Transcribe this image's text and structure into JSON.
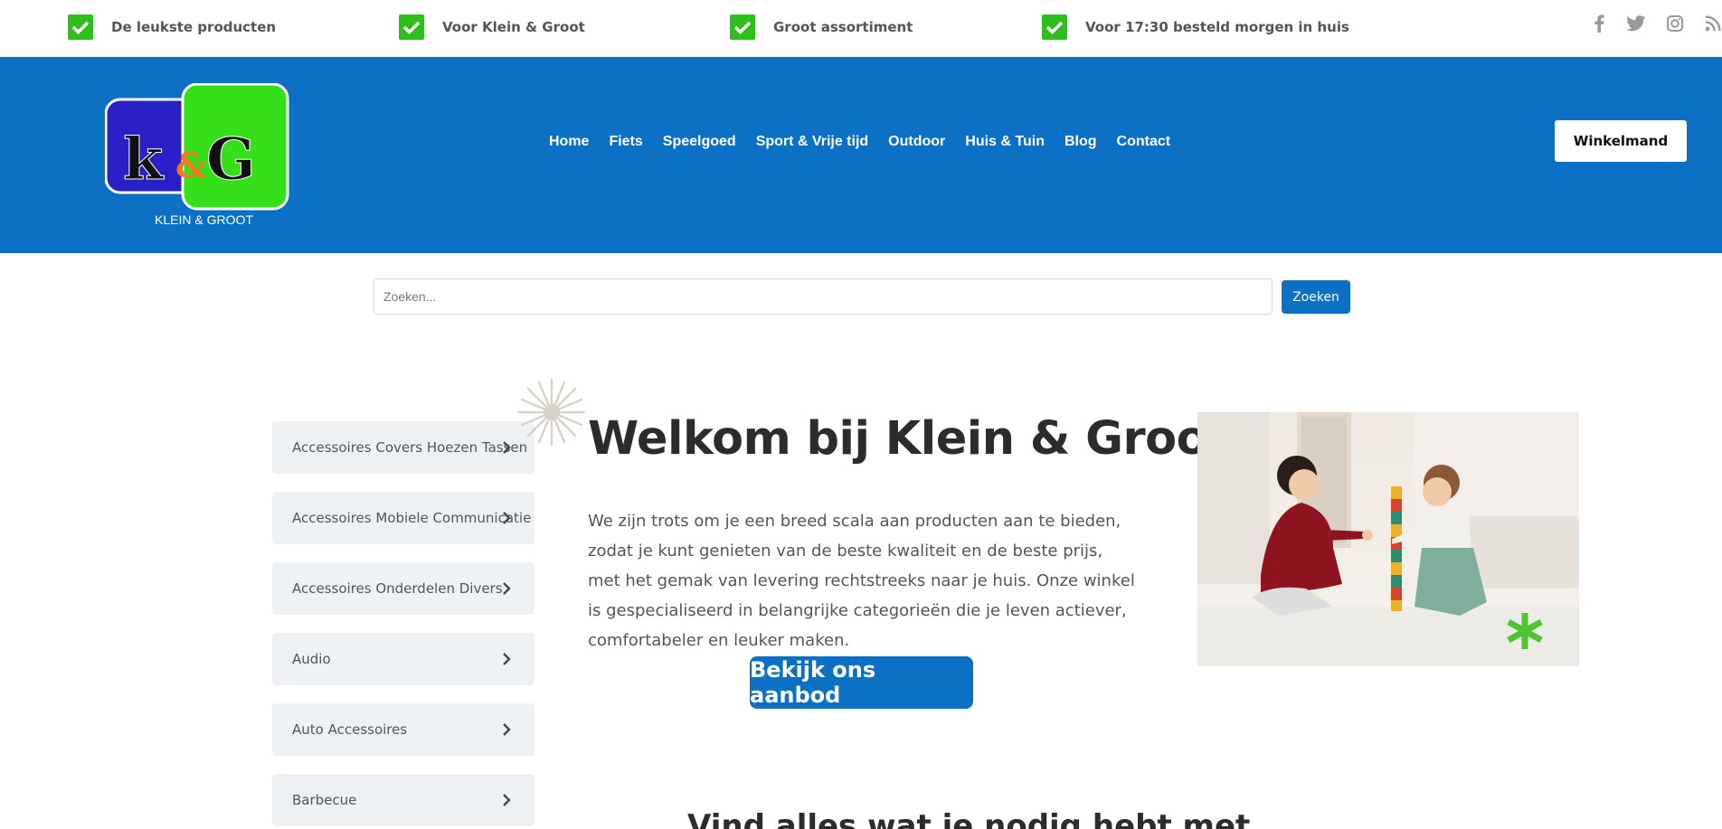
{
  "topbar": {
    "usps": [
      {
        "label": "De leukste producten"
      },
      {
        "label": "Voor Klein & Groot"
      },
      {
        "label": "Groot assortiment"
      },
      {
        "label": "Voor 17:30 besteld morgen in huis"
      }
    ],
    "social_icons": [
      "facebook-icon",
      "twitter-icon",
      "instagram-icon",
      "rss-icon"
    ],
    "check_color": "#2ec01a"
  },
  "header": {
    "background": "#0c70c5",
    "logo": {
      "letters": "k&G",
      "tagline": "KLEIN  & GROOT"
    },
    "nav": [
      "Home",
      "Fiets",
      "Speelgoed",
      "Sport & Vrije tijd",
      "Outdoor",
      "Huis & Tuin",
      "Blog",
      "Contact"
    ],
    "cart_label": "Winkelmand"
  },
  "search": {
    "placeholder": "Zoeken...",
    "value": "",
    "button_label": "Zoeken"
  },
  "sidebar": {
    "categories": [
      {
        "label": "Accessoires Covers Hoezen Tassen"
      },
      {
        "label": "Accessoires Mobiele Communicatie"
      },
      {
        "label": "Accessoires Onderdelen Divers"
      },
      {
        "label": "Audio"
      },
      {
        "label": "Auto Accessoires"
      },
      {
        "label": "Barbecue"
      }
    ]
  },
  "hero": {
    "title": "Welkom bij Klein & Groot",
    "text": "We zijn trots om je een breed scala aan producten aan te bieden, zodat je kunt genieten van de beste kwaliteit en de beste prijs, met het gemak van levering rechtstreeks naar je huis. Onze winkel is gespecialiseerd in belangrijke categorieën die je leven actiever, comfortabeler en leuker maken.",
    "button_label": "Bekijk ons aanbod"
  },
  "section": {
    "heading": "Vind alles wat je nodig hebt met"
  }
}
